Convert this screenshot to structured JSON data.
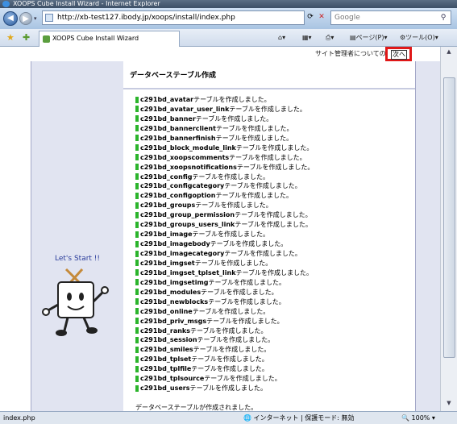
{
  "window": {
    "title": "XOOPS Cube Install Wizard - Internet Explorer"
  },
  "address_bar": {
    "url": "http://xb-test127.ibody.jp/xoops/install/index.php",
    "search_placeholder": "Google"
  },
  "command_bar": {
    "tab_title": "XOOPS Cube Install Wizard",
    "page_menu": "ページ(P)",
    "tools_menu": "ツール(O)"
  },
  "page": {
    "settings_link": "サイト管理者についての設定 >",
    "next_button": "次へ",
    "lets_start": "Let's Start !!",
    "heading": "データベーステーブル作成",
    "table_suffix": "テーブルを作成しました。",
    "tables": [
      "c291bd_avatar",
      "c291bd_avatar_user_link",
      "c291bd_banner",
      "c291bd_bannerclient",
      "c291bd_bannerfinish",
      "c291bd_block_module_link",
      "c291bd_xoopscomments",
      "c291bd_xoopsnotifications",
      "c291bd_config",
      "c291bd_configcategory",
      "c291bd_configoption",
      "c291bd_groups",
      "c291bd_group_permission",
      "c291bd_groups_users_link",
      "c291bd_image",
      "c291bd_imagebody",
      "c291bd_imagecategory",
      "c291bd_imgset",
      "c291bd_imgset_tplset_link",
      "c291bd_imgsetimg",
      "c291bd_modules",
      "c291bd_newblocks",
      "c291bd_online",
      "c291bd_priv_msgs",
      "c291bd_ranks",
      "c291bd_session",
      "c291bd_smiles",
      "c291bd_tplset",
      "c291bd_tplfile",
      "c291bd_tplsource",
      "c291bd_users"
    ],
    "completion_message": "データベーステーブルが作成されました。"
  },
  "status_bar": {
    "left_text": "index.php",
    "zone_text": "インターネット | 保護モード: 無効",
    "zoom": "100%"
  },
  "colors": {
    "highlight_border": "#e01818",
    "success_mark": "#2bb42b",
    "sidebar_bg": "#e1e4f1"
  }
}
